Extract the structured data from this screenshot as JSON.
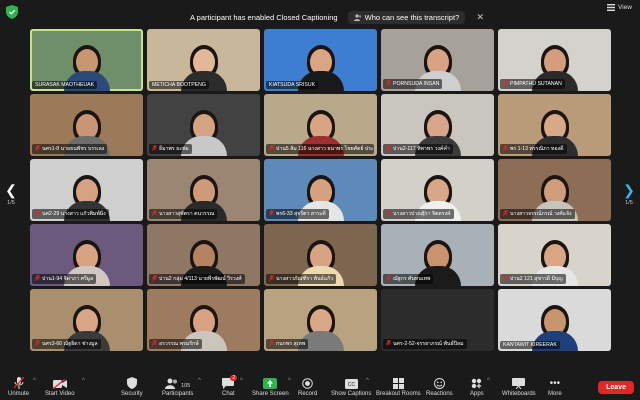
{
  "topbar": {
    "notice": "A participant has enabled Closed Captioning",
    "notice_link": "Who can see this transcript?",
    "view_label": "View"
  },
  "pagination": {
    "left": "1/5",
    "right": "1/5"
  },
  "colors": {
    "accent": "#39b4f3",
    "leave": "#e02828",
    "active_speaker": "#c8e28a",
    "share_green": "#2fb34f"
  },
  "participants": [
    {
      "name": "SURASAK MAOTHEUAK",
      "muted": false,
      "active": true,
      "bg": "#6f8f6a",
      "skin": "#c99672",
      "shirt": "#2b4a7a"
    },
    {
      "name": "METICHA BOOTPENG",
      "muted": false,
      "bg": "#c9b79c",
      "skin": "#e3b899",
      "shirt": "#2c2c2c"
    },
    {
      "name": "KIATSUDA SRISUK",
      "muted": false,
      "bg": "#3e7ed1",
      "skin": "#d9a583",
      "shirt": "#1a1a1a"
    },
    {
      "name": "PORNSUDA INSAN",
      "muted": true,
      "bg": "#a6a29b",
      "skin": "#d7a383",
      "shirt": "#cfcfcf"
    },
    {
      "name": "PIMPATHU SUTANAN",
      "muted": true,
      "bg": "#d4d2cd",
      "skin": "#d49e7e",
      "shirt": "#2a2a2a"
    },
    {
      "name": "นศร1-8 นายธนพัชร บรรเลง",
      "muted": true,
      "bg": "#9b7a5a",
      "skin": "#c99575",
      "shirt": "#6d6d6d"
    },
    {
      "name": "ธีมาพร ธะพ่อ",
      "muted": true,
      "bg": "#424242",
      "skin": "#d4a383",
      "shirt": "#c8c8c8"
    },
    {
      "name": "ปาน5 ส้ม 116 นางสาว ธนาพร ไชยศัตย์ ประจ",
      "muted": true,
      "bg": "#b9a98b",
      "skin": "#d8a584",
      "shirt": "#9c2f2f"
    },
    {
      "name": "ปาน2-117 ทิพาพร วงค์คำ",
      "muted": true,
      "bg": "#c9c6c0",
      "skin": "#d7a688",
      "shirt": "#3b3b3b"
    },
    {
      "name": "พร 1-13 พรรณิภา ทองดี",
      "muted": true,
      "bg": "#b99b79",
      "skin": "#d9a888",
      "shirt": "#2e2e2e"
    },
    {
      "name": "นศ2-29 นางสาว แก้วพิมพ์มิ่ง",
      "muted": true,
      "bg": "#cfcfcf",
      "skin": "#d6a282",
      "shirt": "#343434"
    },
    {
      "name": "นางสาวสุพัตรา ตนวรรณ",
      "muted": true,
      "bg": "#9a8672",
      "skin": "#cf9a78",
      "shirt": "#2a2a2a"
    },
    {
      "name": "พร6-33 สุจรีตา สาระดี",
      "muted": true,
      "bg": "#5d8ab8",
      "skin": "#d5a180",
      "shirt": "#e5e5e5"
    },
    {
      "name": "นางสาวปาณฐิรา จิตตรงค์",
      "muted": true,
      "bg": "#d3d0ca",
      "skin": "#d9a686",
      "shirt": "#f0f0f0"
    },
    {
      "name": "นางสาวจรรณ์ภรณ์ วงศ์แจ้ง",
      "muted": true,
      "bg": "#8e6d56",
      "skin": "#cf9c7c",
      "shirt": "#c8c3bb"
    },
    {
      "name": "ปาน1-94 จิดาภา ศรีมูล",
      "muted": true,
      "bg": "#6b5a7e",
      "skin": "#d7a383",
      "shirt": "#d0c8c0"
    },
    {
      "name": "ปาน2 กลุ่ม 4/113 นายพีรพัฒน์ วิรวงศ์",
      "muted": true,
      "bg": "#8f7766",
      "skin": "#b5835f",
      "shirt": "#1e1e1e"
    },
    {
      "name": "นางสาวภัณฑิรา พันธ์แก้ว",
      "muted": true,
      "bg": "#7d6650",
      "skin": "#d6a383",
      "shirt": "#ecd9b0"
    },
    {
      "name": "ณัฐกร ศันทนเทพ",
      "muted": true,
      "bg": "#a9b1b8",
      "skin": "#c9936f",
      "shirt": "#1b1b1b"
    },
    {
      "name": "ปาน2 121 สุชาวดี มีบุญ",
      "muted": true,
      "bg": "#d8d4cc",
      "skin": "#d8a585",
      "shirt": "#e6e6e6"
    },
    {
      "name": "นศร3-60 ณัฐธิดา ช่างมูล",
      "muted": true,
      "bg": "#a98f6d",
      "skin": "#d8a585",
      "shirt": "#3a3a3a"
    },
    {
      "name": "อรวรรณ พรมรักษ์",
      "muted": true,
      "bg": "#9c7b5f",
      "skin": "#d6a282",
      "shirt": "#cbc5bd"
    },
    {
      "name": "กนกพร สุเทพ",
      "muted": true,
      "bg": "#b9a27f",
      "skin": "#d9a888",
      "shirt": "#7a7a7a"
    },
    {
      "name": "นศร-2-52-จรรยาภรณ์ พันธ์ปิลม",
      "muted": true,
      "bg": "#2c2c2c",
      "skin": "",
      "shirt": ""
    },
    {
      "name": "KANTAWIT KIREERAK",
      "muted": false,
      "bg": "#dadada",
      "skin": "#c9956f",
      "shirt": "#1e3f7a"
    }
  ],
  "toolbar": {
    "unmute": "Unmute",
    "start_video": "Start Video",
    "security": "Security",
    "participants": "Participants",
    "participants_count": "105",
    "chat": "Chat",
    "chat_badge": "2",
    "share_screen": "Share Screen",
    "record": "Record",
    "show_captions": "Show Captions",
    "breakout_rooms": "Breakout Rooms",
    "reactions": "Reactions",
    "apps": "Apps",
    "whiteboards": "Whiteboards",
    "more": "More",
    "leave": "Leave"
  }
}
